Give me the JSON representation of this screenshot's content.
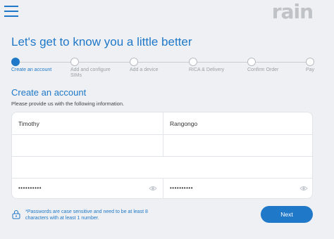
{
  "header": {
    "logo": "rain",
    "menu_icon": "hamburger-menu-icon"
  },
  "page_title": "Let's get to know you a little better",
  "steps": [
    {
      "label": "Create an account",
      "active": true
    },
    {
      "label": "Add and configure SIMs",
      "active": false
    },
    {
      "label": "Add a device",
      "active": false
    },
    {
      "label": "RICA & Delivery",
      "active": false
    },
    {
      "label": "Confirm Order",
      "active": false
    },
    {
      "label": "Pay",
      "active": false
    }
  ],
  "section": {
    "title": "Create an account",
    "subtitle": "Please provide us with the following information."
  },
  "form": {
    "first_name": "Timothy",
    "last_name": "Rangongo",
    "email": "",
    "mobile": "",
    "id_number": "",
    "password": "••••••••••",
    "confirm_password": "••••••••••"
  },
  "password_note": "*Passwords are case sensitive and need to be at least 8 characters with at least 1 number.",
  "next_label": "Next",
  "colors": {
    "accent": "#1f78c8",
    "logo": "#bfc2c6",
    "background": "#eef0f3"
  }
}
